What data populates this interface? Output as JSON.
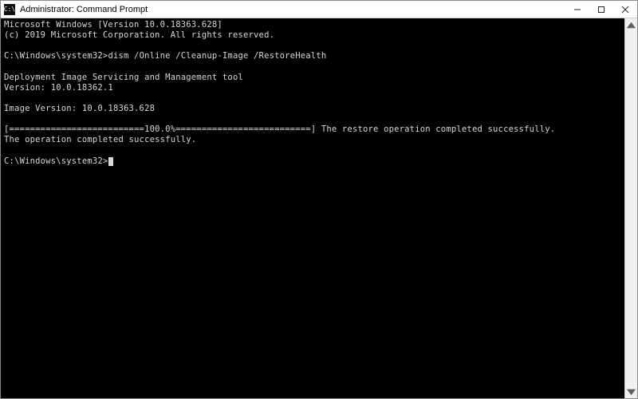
{
  "window": {
    "title": "Administrator: Command Prompt",
    "icon_glyph": "C:\\"
  },
  "terminal": {
    "header_line1": "Microsoft Windows [Version 10.0.18363.628]",
    "header_line2": "(c) 2019 Microsoft Corporation. All rights reserved.",
    "prompt1_path": "C:\\Windows\\system32>",
    "prompt1_cmd": "dism /Online /Cleanup-Image /RestoreHealth",
    "tool_line1": "Deployment Image Servicing and Management tool",
    "tool_line2": "Version: 10.0.18362.1",
    "image_version": "Image Version: 10.0.18363.628",
    "progress_line": "[==========================100.0%==========================] The restore operation completed successfully.",
    "success_line": "The operation completed successfully.",
    "prompt2_path": "C:\\Windows\\system32>"
  }
}
